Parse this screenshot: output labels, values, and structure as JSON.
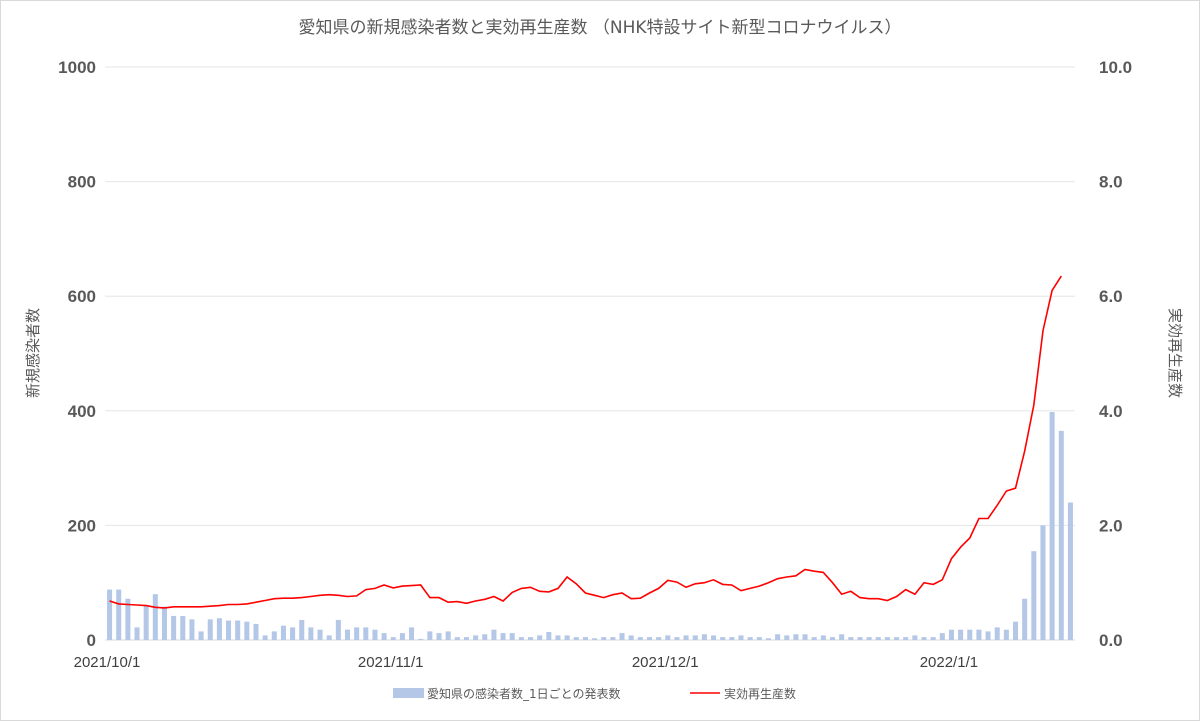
{
  "chart_data": {
    "type": "bar",
    "title": "愛知県の新規感染者数と実効再生産数 （NHK特設サイト新型コロナウイルス）",
    "ylabel": "新規感染者数",
    "y2label": "実効再生産数",
    "ylim": [
      0,
      1000
    ],
    "y2lim": [
      0,
      10
    ],
    "yticks": [
      "0",
      "200",
      "400",
      "600",
      "800",
      "1000"
    ],
    "y2ticks": [
      "0.0",
      "2.0",
      "4.0",
      "6.0",
      "8.0",
      "10.0"
    ],
    "x_tick_labels": [
      {
        "label": "2021/10/1",
        "index": 0
      },
      {
        "label": "2021/11/1",
        "index": 31
      },
      {
        "label": "2021/12/1",
        "index": 61
      },
      {
        "label": "2022/1/1",
        "index": 92
      }
    ],
    "x_start": "2021/10/1",
    "legend_position": "bottom",
    "grid": true,
    "series": [
      {
        "name": "愛知県の感染者数_1日ごとの発表数",
        "type": "bar",
        "color": "#b4c7e7",
        "axis": "left",
        "values": [
          88,
          88,
          72,
          22,
          60,
          80,
          58,
          42,
          42,
          36,
          15,
          36,
          38,
          34,
          34,
          32,
          28,
          8,
          15,
          25,
          22,
          35,
          22,
          18,
          8,
          35,
          18,
          22,
          22,
          18,
          12,
          5,
          12,
          22,
          2,
          15,
          12,
          15,
          5,
          5,
          8,
          10,
          18,
          12,
          12,
          5,
          5,
          8,
          14,
          8,
          8,
          5,
          5,
          3,
          5,
          5,
          12,
          8,
          5,
          5,
          5,
          8,
          5,
          8,
          8,
          10,
          8,
          5,
          5,
          8,
          5,
          5,
          3,
          10,
          8,
          10,
          10,
          5,
          8,
          5,
          10,
          5,
          5,
          5,
          5,
          5,
          5,
          5,
          8,
          5,
          5,
          12,
          18,
          18,
          18,
          18,
          15,
          22,
          18,
          32,
          72,
          155,
          200,
          398,
          365,
          240
        ]
      },
      {
        "name": "実効再生産数",
        "type": "line",
        "color": "#ff0000",
        "axis": "right",
        "values": [
          0.68,
          0.63,
          0.62,
          0.61,
          0.6,
          0.57,
          0.56,
          0.58,
          0.58,
          0.58,
          0.58,
          0.59,
          0.6,
          0.62,
          0.62,
          0.63,
          0.66,
          0.69,
          0.72,
          0.73,
          0.73,
          0.74,
          0.76,
          0.78,
          0.79,
          0.78,
          0.76,
          0.77,
          0.88,
          0.9,
          0.96,
          0.91,
          0.94,
          0.95,
          0.96,
          0.74,
          0.74,
          0.66,
          0.67,
          0.64,
          0.68,
          0.71,
          0.76,
          0.68,
          0.83,
          0.9,
          0.92,
          0.85,
          0.84,
          0.9,
          1.1,
          0.98,
          0.82,
          0.78,
          0.74,
          0.79,
          0.82,
          0.72,
          0.73,
          0.82,
          0.9,
          1.04,
          1.01,
          0.92,
          0.98,
          1.0,
          1.05,
          0.97,
          0.96,
          0.86,
          0.9,
          0.94,
          1.0,
          1.07,
          1.1,
          1.12,
          1.23,
          1.2,
          1.18,
          1.0,
          0.8,
          0.85,
          0.74,
          0.72,
          0.72,
          0.69,
          0.76,
          0.88,
          0.8,
          1.0,
          0.97,
          1.05,
          1.42,
          1.62,
          1.78,
          2.12,
          2.12,
          2.35,
          2.6,
          2.65,
          3.3,
          4.1,
          5.4,
          6.1,
          6.35
        ]
      }
    ]
  }
}
